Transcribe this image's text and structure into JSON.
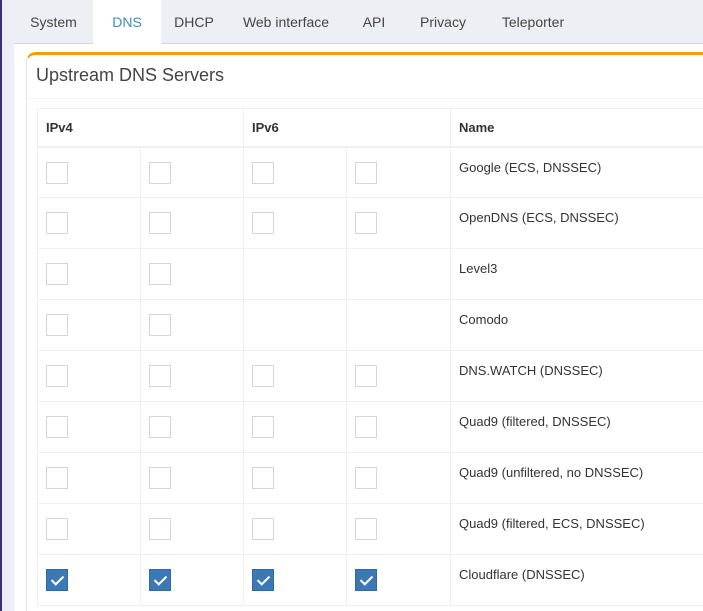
{
  "tabs": [
    {
      "label": "System",
      "active": false
    },
    {
      "label": "DNS",
      "active": true
    },
    {
      "label": "DHCP",
      "active": false
    },
    {
      "label": "Web interface",
      "active": false
    },
    {
      "label": "API",
      "active": false
    },
    {
      "label": "Privacy",
      "active": false
    },
    {
      "label": "Teleporter",
      "active": false
    }
  ],
  "upstream": {
    "title": "Upstream DNS Servers",
    "headers": {
      "ipv4": "IPv4",
      "ipv6": "IPv6",
      "name": "Name"
    },
    "rows": [
      {
        "name": "Google (ECS, DNSSEC)",
        "ipv4": [
          false,
          false
        ],
        "ipv6": [
          false,
          false
        ]
      },
      {
        "name": "OpenDNS (ECS, DNSSEC)",
        "ipv4": [
          false,
          false
        ],
        "ipv6": [
          false,
          false
        ]
      },
      {
        "name": "Level3",
        "ipv4": [
          false,
          false
        ],
        "ipv6": []
      },
      {
        "name": "Comodo",
        "ipv4": [
          false,
          false
        ],
        "ipv6": []
      },
      {
        "name": "DNS.WATCH (DNSSEC)",
        "ipv4": [
          false,
          false
        ],
        "ipv6": [
          false,
          false
        ]
      },
      {
        "name": "Quad9 (filtered, DNSSEC)",
        "ipv4": [
          false,
          false
        ],
        "ipv6": [
          false,
          false
        ]
      },
      {
        "name": "Quad9 (unfiltered, no DNSSEC)",
        "ipv4": [
          false,
          false
        ],
        "ipv6": [
          false,
          false
        ]
      },
      {
        "name": "Quad9 (filtered, ECS, DNSSEC)",
        "ipv4": [
          false,
          false
        ],
        "ipv6": [
          false,
          false
        ]
      },
      {
        "name": "Cloudflare (DNSSEC)",
        "ipv4": [
          true,
          true
        ],
        "ipv6": [
          true,
          true
        ]
      }
    ]
  },
  "colors": {
    "accent": "#3c8dbc",
    "box_top_border": "#f39c12",
    "checkbox_checked": "#3c78b5",
    "sidebar_edge": "#3c2f7a"
  }
}
